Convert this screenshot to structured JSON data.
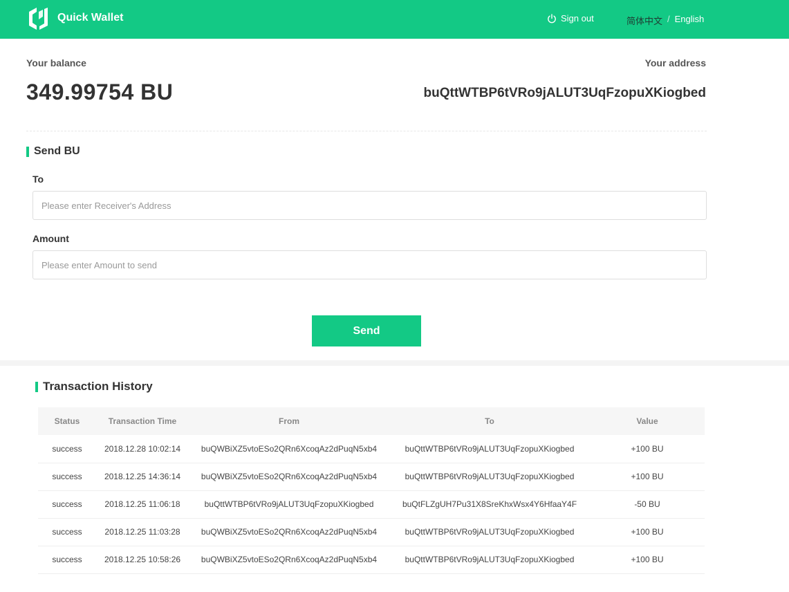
{
  "header": {
    "brand": "Quick Wallet",
    "signout": "Sign out",
    "lang_cn": "简体中文",
    "lang_sep": "/",
    "lang_en": "English",
    "accent": "#13c985"
  },
  "wallet": {
    "balance_label": "Your balance",
    "balance": "349.99754 BU",
    "address_label": "Your address",
    "address": "buQttWTBP6tVRo9jALUT3UqFzopuXKiogbed"
  },
  "send": {
    "title": "Send BU",
    "to_label": "To",
    "to_placeholder": "Please enter Receiver's Address",
    "amount_label": "Amount",
    "amount_placeholder": "Please enter Amount to send",
    "button": "Send"
  },
  "history": {
    "title": "Transaction History",
    "columns": [
      "Status",
      "Transaction Time",
      "From",
      "To",
      "Value"
    ],
    "rows": [
      [
        "success",
        "2018.12.28 10:02:14",
        "buQWBiXZ5vtoESo2QRn6XcoqAz2dPuqN5xb4",
        "buQttWTBP6tVRo9jALUT3UqFzopuXKiogbed",
        "+100 BU"
      ],
      [
        "success",
        "2018.12.25 14:36:14",
        "buQWBiXZ5vtoESo2QRn6XcoqAz2dPuqN5xb4",
        "buQttWTBP6tVRo9jALUT3UqFzopuXKiogbed",
        "+100 BU"
      ],
      [
        "success",
        "2018.12.25 11:06:18",
        "buQttWTBP6tVRo9jALUT3UqFzopuXKiogbed",
        "buQtFLZgUH7Pu31X8SreKhxWsx4Y6HfaaY4F",
        "-50 BU"
      ],
      [
        "success",
        "2018.12.25 11:03:28",
        "buQWBiXZ5vtoESo2QRn6XcoqAz2dPuqN5xb4",
        "buQttWTBP6tVRo9jALUT3UqFzopuXKiogbed",
        "+100 BU"
      ],
      [
        "success",
        "2018.12.25 10:58:26",
        "buQWBiXZ5vtoESo2QRn6XcoqAz2dPuqN5xb4",
        "buQttWTBP6tVRo9jALUT3UqFzopuXKiogbed",
        "+100 BU"
      ]
    ]
  }
}
